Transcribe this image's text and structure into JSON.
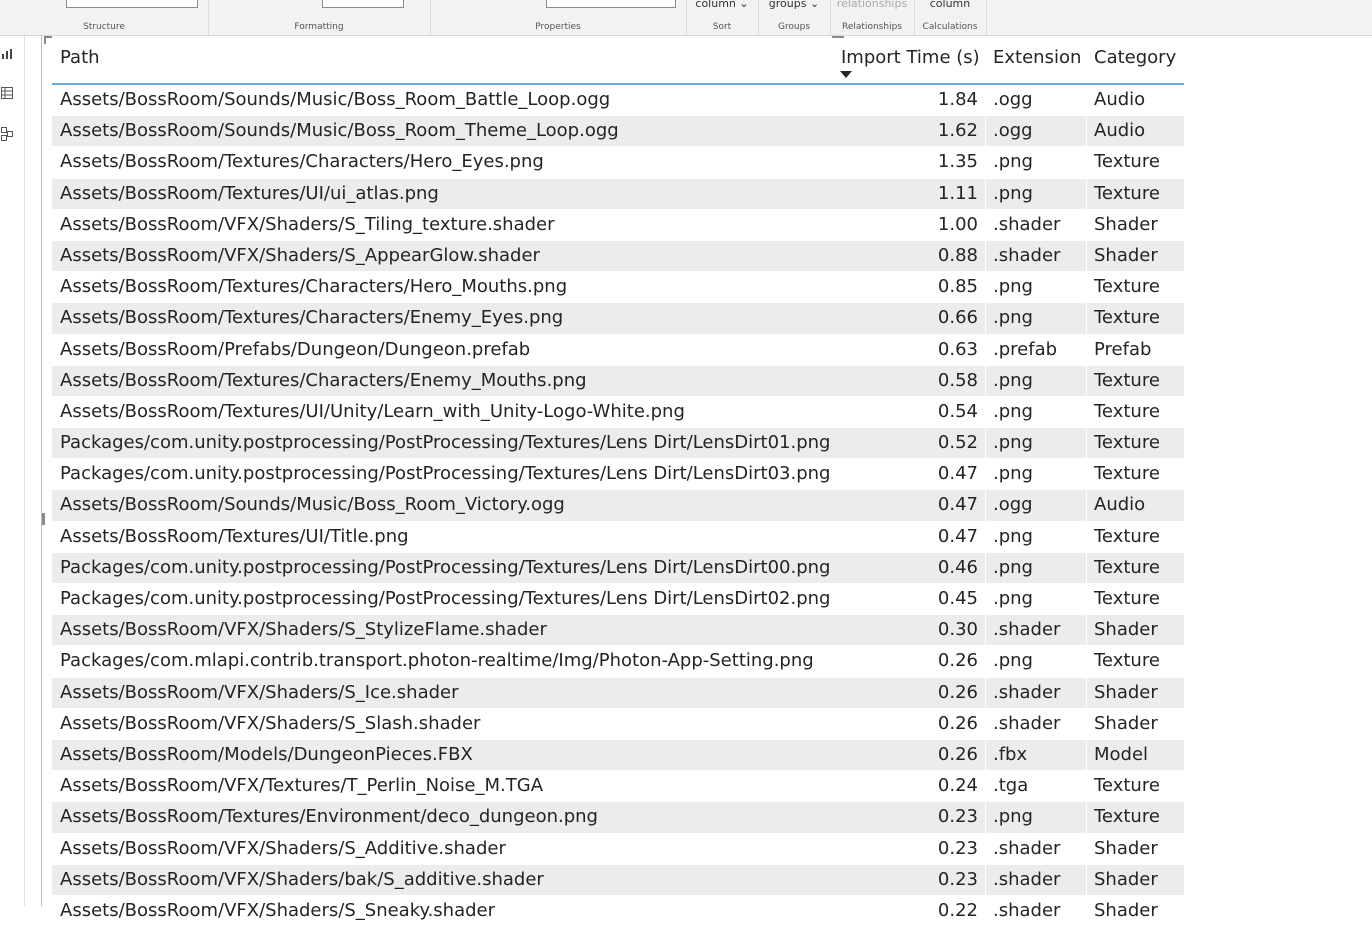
{
  "ribbon": {
    "groups": [
      {
        "name": "structure",
        "label": "Structure",
        "button": ""
      },
      {
        "name": "formatting",
        "label": "Formatting",
        "button": ""
      },
      {
        "name": "properties",
        "label": "Properties",
        "button": ""
      },
      {
        "name": "sort",
        "label": "Sort",
        "button": "column"
      },
      {
        "name": "groups",
        "label": "Groups",
        "button": "groups"
      },
      {
        "name": "relationships",
        "label": "Relationships",
        "button": "relationships"
      },
      {
        "name": "calculations",
        "label": "Calculations",
        "button": "column"
      }
    ]
  },
  "table": {
    "columns": {
      "path": "Path",
      "import_time": "Import Time (s)",
      "extension": "Extension",
      "category": "Category"
    },
    "sort": {
      "column": "Import Time (s)",
      "direction": "descending"
    },
    "rows": [
      {
        "path": "Assets/BossRoom/Sounds/Music/Boss_Room_Battle_Loop.ogg",
        "time": "1.84",
        "ext": ".ogg",
        "cat": "Audio"
      },
      {
        "path": "Assets/BossRoom/Sounds/Music/Boss_Room_Theme_Loop.ogg",
        "time": "1.62",
        "ext": ".ogg",
        "cat": "Audio"
      },
      {
        "path": "Assets/BossRoom/Textures/Characters/Hero_Eyes.png",
        "time": "1.35",
        "ext": ".png",
        "cat": "Texture"
      },
      {
        "path": "Assets/BossRoom/Textures/UI/ui_atlas.png",
        "time": "1.11",
        "ext": ".png",
        "cat": "Texture"
      },
      {
        "path": "Assets/BossRoom/VFX/Shaders/S_Tiling_texture.shader",
        "time": "1.00",
        "ext": ".shader",
        "cat": "Shader"
      },
      {
        "path": "Assets/BossRoom/VFX/Shaders/S_AppearGlow.shader",
        "time": "0.88",
        "ext": ".shader",
        "cat": "Shader"
      },
      {
        "path": "Assets/BossRoom/Textures/Characters/Hero_Mouths.png",
        "time": "0.85",
        "ext": ".png",
        "cat": "Texture"
      },
      {
        "path": "Assets/BossRoom/Textures/Characters/Enemy_Eyes.png",
        "time": "0.66",
        "ext": ".png",
        "cat": "Texture"
      },
      {
        "path": "Assets/BossRoom/Prefabs/Dungeon/Dungeon.prefab",
        "time": "0.63",
        "ext": ".prefab",
        "cat": "Prefab"
      },
      {
        "path": "Assets/BossRoom/Textures/Characters/Enemy_Mouths.png",
        "time": "0.58",
        "ext": ".png",
        "cat": "Texture"
      },
      {
        "path": "Assets/BossRoom/Textures/UI/Unity/Learn_with_Unity-Logo-White.png",
        "time": "0.54",
        "ext": ".png",
        "cat": "Texture"
      },
      {
        "path": "Packages/com.unity.postprocessing/PostProcessing/Textures/Lens Dirt/LensDirt01.png",
        "time": "0.52",
        "ext": ".png",
        "cat": "Texture"
      },
      {
        "path": "Packages/com.unity.postprocessing/PostProcessing/Textures/Lens Dirt/LensDirt03.png",
        "time": "0.47",
        "ext": ".png",
        "cat": "Texture"
      },
      {
        "path": "Assets/BossRoom/Sounds/Music/Boss_Room_Victory.ogg",
        "time": "0.47",
        "ext": ".ogg",
        "cat": "Audio"
      },
      {
        "path": "Assets/BossRoom/Textures/UI/Title.png",
        "time": "0.47",
        "ext": ".png",
        "cat": "Texture"
      },
      {
        "path": "Packages/com.unity.postprocessing/PostProcessing/Textures/Lens Dirt/LensDirt00.png",
        "time": "0.46",
        "ext": ".png",
        "cat": "Texture"
      },
      {
        "path": "Packages/com.unity.postprocessing/PostProcessing/Textures/Lens Dirt/LensDirt02.png",
        "time": "0.45",
        "ext": ".png",
        "cat": "Texture"
      },
      {
        "path": "Assets/BossRoom/VFX/Shaders/S_StylizeFlame.shader",
        "time": "0.30",
        "ext": ".shader",
        "cat": "Shader"
      },
      {
        "path": "Packages/com.mlapi.contrib.transport.photon-realtime/Img/Photon-App-Setting.png",
        "time": "0.26",
        "ext": ".png",
        "cat": "Texture"
      },
      {
        "path": "Assets/BossRoom/VFX/Shaders/S_Ice.shader",
        "time": "0.26",
        "ext": ".shader",
        "cat": "Shader"
      },
      {
        "path": "Assets/BossRoom/VFX/Shaders/S_Slash.shader",
        "time": "0.26",
        "ext": ".shader",
        "cat": "Shader"
      },
      {
        "path": "Assets/BossRoom/Models/DungeonPieces.FBX",
        "time": "0.26",
        "ext": ".fbx",
        "cat": "Model"
      },
      {
        "path": "Assets/BossRoom/VFX/Textures/T_Perlin_Noise_M.TGA",
        "time": "0.24",
        "ext": ".tga",
        "cat": "Texture"
      },
      {
        "path": "Assets/BossRoom/Textures/Environment/deco_dungeon.png",
        "time": "0.23",
        "ext": ".png",
        "cat": "Texture"
      },
      {
        "path": "Assets/BossRoom/VFX/Shaders/S_Additive.shader",
        "time": "0.23",
        "ext": ".shader",
        "cat": "Shader"
      },
      {
        "path": "Assets/BossRoom/VFX/Shaders/bak/S_additive.shader",
        "time": "0.23",
        "ext": ".shader",
        "cat": "Shader"
      },
      {
        "path": "Assets/BossRoom/VFX/Shaders/S_Sneaky.shader",
        "time": "0.22",
        "ext": ".shader",
        "cat": "Shader"
      }
    ]
  },
  "rail": {
    "icons": [
      "report-view-icon",
      "data-view-icon",
      "model-view-icon"
    ]
  }
}
